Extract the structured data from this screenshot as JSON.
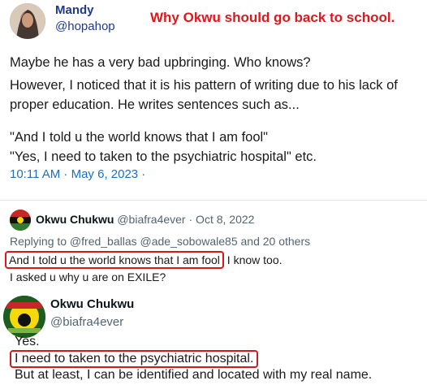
{
  "tweet": {
    "author_name": "Mandy",
    "author_handle": "@hopahop",
    "headline": "Why Okwu should go back to school.",
    "lines": [
      "Maybe he has a very bad upbringing. Who knows?",
      "However, I noticed that it is his pattern of writing due to his lack of",
      "proper education. He writes sentences  such as...",
      "\"And I told u the world knows that I am fool\"",
      "\"Yes, I need to taken to the psychiatric hospital\" etc."
    ],
    "timestamp": "10:11 AM · May 6, 2023 ·"
  },
  "reply": {
    "author_name": "Okwu Chukwu",
    "author_handle": "@biafra4ever",
    "date": "· Oct 8, 2022",
    "replying_to": "Replying to @fred_ballas @ade_sobowale85 and 20 others",
    "line1_highlight": "And I told u the world knows that I am fool",
    "line1_rest": " I know too.",
    "line2": "I asked u why u are on EXILE?"
  },
  "post2": {
    "author_name": "Okwu Chukwu",
    "author_handle": "@biafra4ever",
    "line1": "Yes.",
    "line2_highlight": "I need to taken to the psychiatric hospital.",
    "line3": "But at least, I can be identified and located with my real name."
  },
  "colors": {
    "headline": "#e0161b",
    "link": "#1d6fb8",
    "highlight_box": "#d31a1a"
  }
}
